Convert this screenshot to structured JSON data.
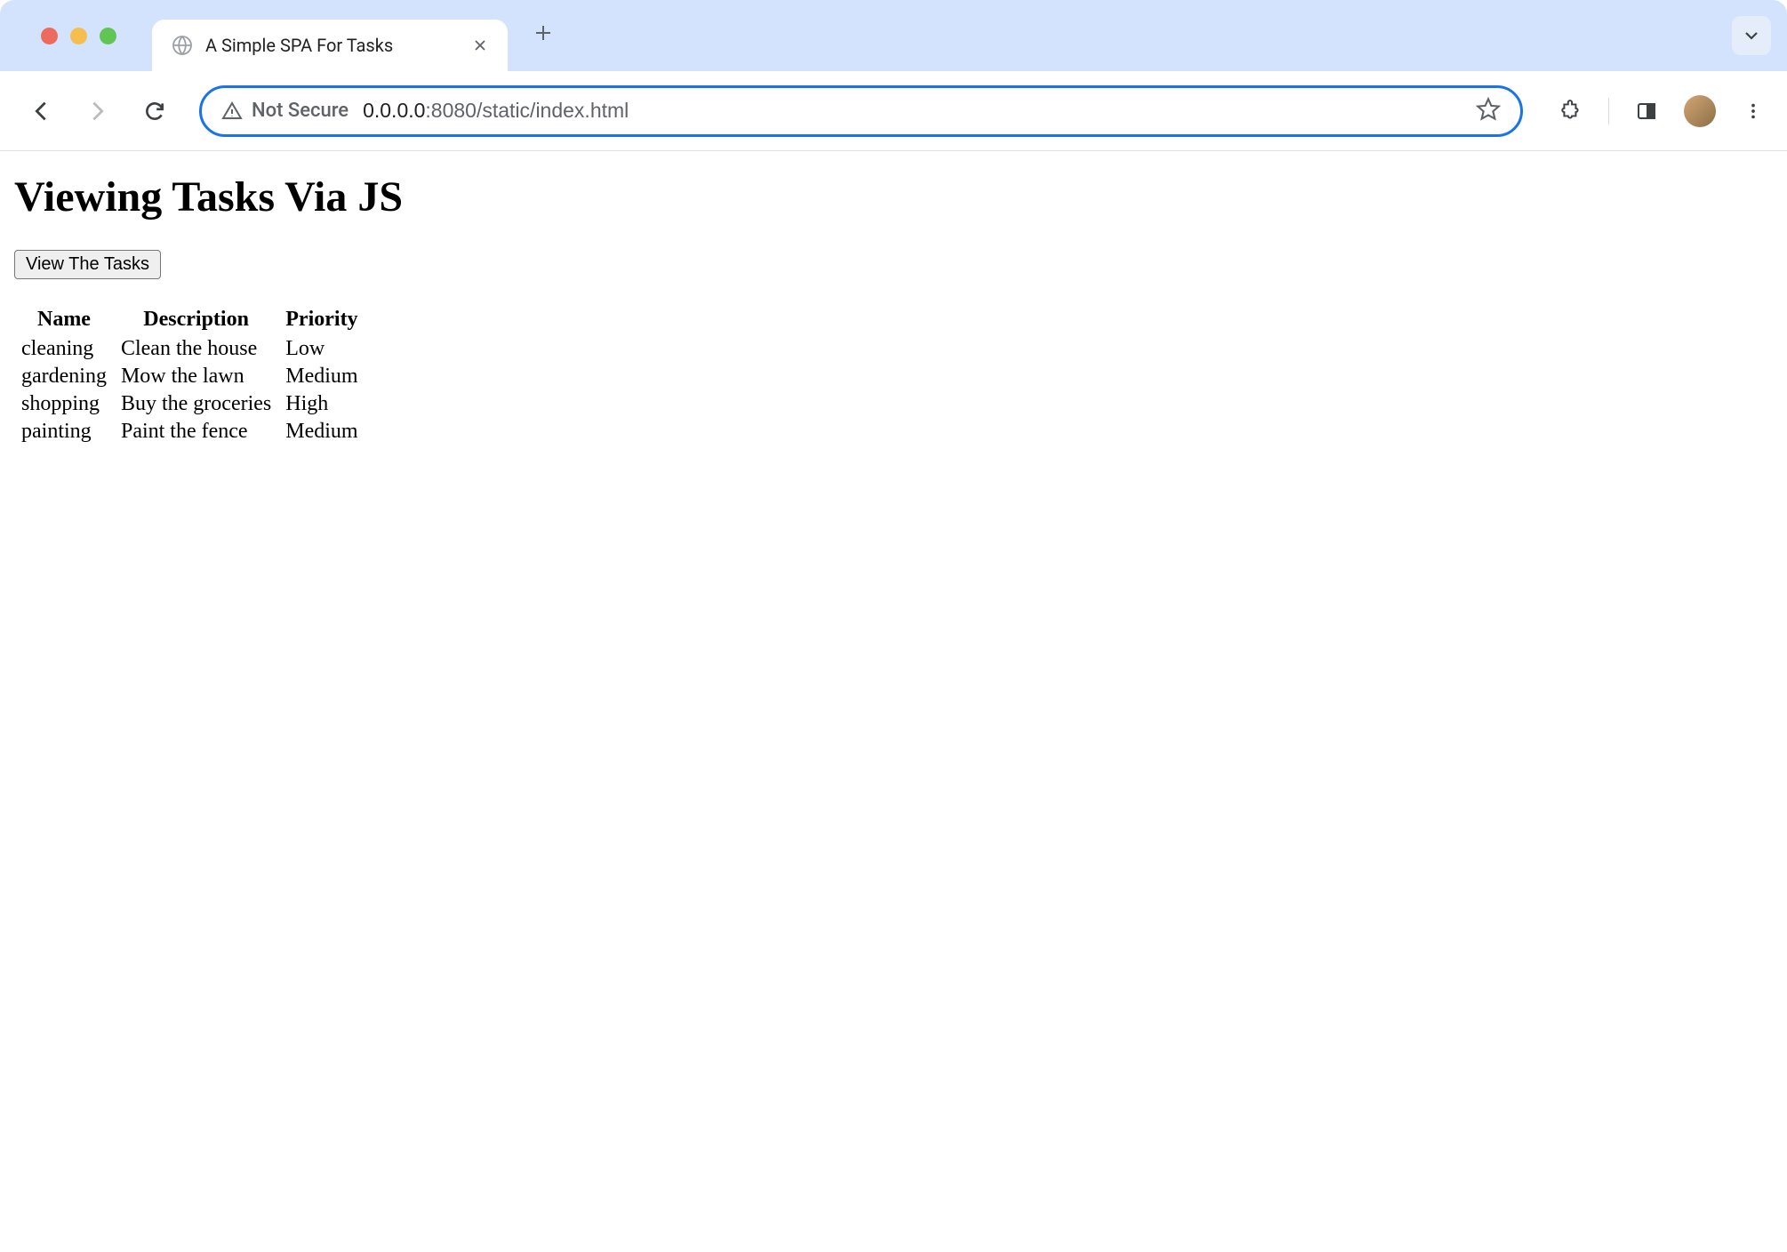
{
  "browser": {
    "tab_title": "A Simple SPA For Tasks",
    "security_label": "Not Secure",
    "url_domain": "0.0.0.0",
    "url_path": ":8080/static/index.html"
  },
  "page": {
    "heading": "Viewing Tasks Via JS",
    "button_label": "View The Tasks",
    "table": {
      "headers": [
        "Name",
        "Description",
        "Priority"
      ],
      "rows": [
        {
          "name": "cleaning",
          "description": "Clean the house",
          "priority": "Low"
        },
        {
          "name": "gardening",
          "description": "Mow the lawn",
          "priority": "Medium"
        },
        {
          "name": "shopping",
          "description": "Buy the groceries",
          "priority": "High"
        },
        {
          "name": "painting",
          "description": "Paint the fence",
          "priority": "Medium"
        }
      ]
    }
  }
}
